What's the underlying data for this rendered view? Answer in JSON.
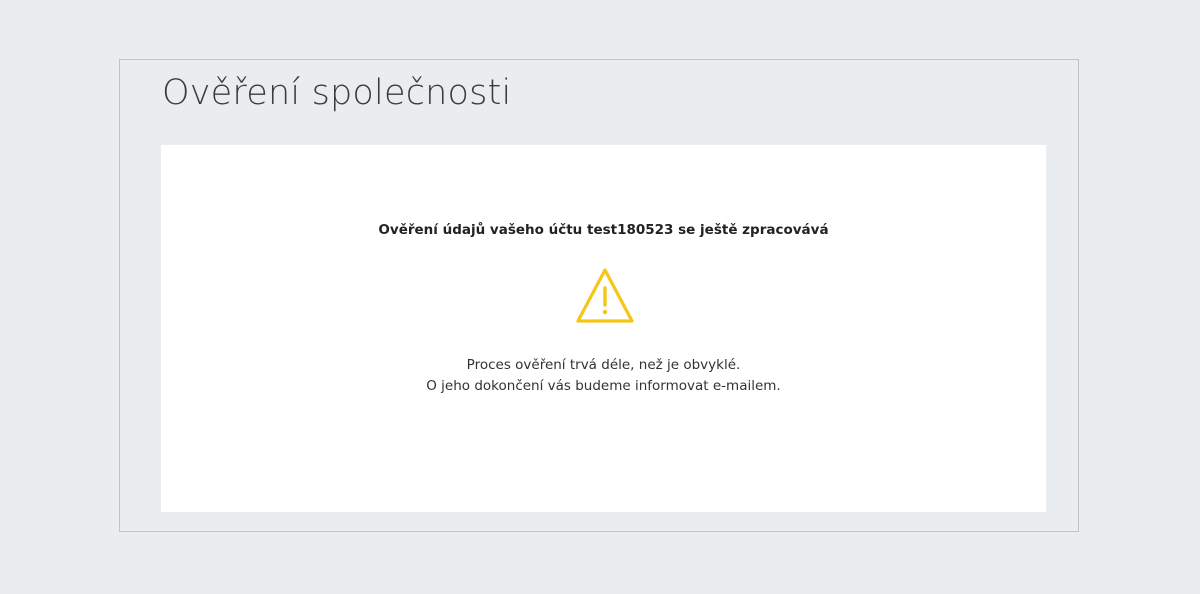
{
  "page": {
    "title": "Ověření společnosti"
  },
  "verification": {
    "heading": "Ověření údajů vašeho účtu test180523 se ještě zpracovává",
    "status_icon": "warning-triangle-icon",
    "message_line1": "Proces ověření trvá déle, než je obvyklé.",
    "message_line2": "O jeho dokončení vás budeme informovat e-mailem."
  },
  "colors": {
    "background": "#eaedf0",
    "panel_border": "#bfc3c7",
    "card": "#ffffff",
    "warning": "#f5c518",
    "text": "#222222"
  }
}
